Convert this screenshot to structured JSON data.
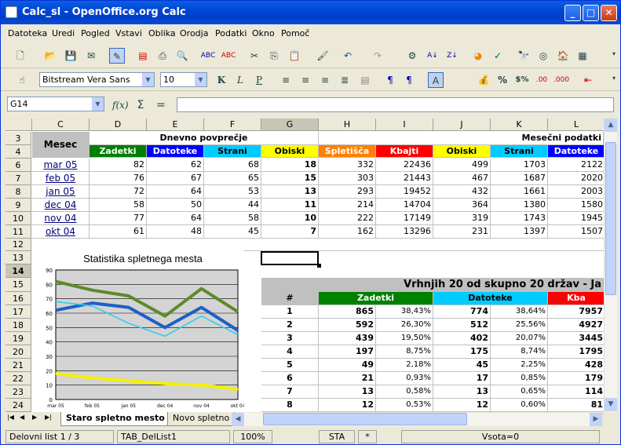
{
  "window": {
    "title": "Calc_sl - OpenOffice.org Calc"
  },
  "menu": [
    "Datoteka",
    "Uredi",
    "Pogled",
    "Vstavi",
    "Oblika",
    "Orodja",
    "Podatki",
    "Okno",
    "Pomoč"
  ],
  "format": {
    "font": "Bitstream Vera Sans",
    "size": "10"
  },
  "formula": {
    "cell_ref": "G14",
    "value": ""
  },
  "columns": [
    "C",
    "D",
    "E",
    "F",
    "G",
    "H",
    "I",
    "J",
    "K",
    "L"
  ],
  "headers": {
    "mesec": "Mesec",
    "dnevno": "Dnevno povprečje",
    "mesecni": "Mesečni podatki",
    "zadetki": "Zadetki",
    "datoteke": "Datoteke",
    "strani": "Strani",
    "obiski": "Obiski",
    "spletisca": "Spletišča",
    "kbajti": "Kbajti"
  },
  "rows": [
    {
      "row": "6",
      "mesec": "mar 05",
      "d": "82",
      "e": "62",
      "f": "68",
      "g": "18",
      "h": "332",
      "i": "22436",
      "j": "499",
      "k": "1703",
      "l": "2122"
    },
    {
      "row": "7",
      "mesec": "feb 05",
      "d": "76",
      "e": "67",
      "f": "65",
      "g": "15",
      "h": "303",
      "i": "21443",
      "j": "467",
      "k": "1687",
      "l": "2020"
    },
    {
      "row": "8",
      "mesec": "jan 05",
      "d": "72",
      "e": "64",
      "f": "53",
      "g": "13",
      "h": "293",
      "i": "19452",
      "j": "432",
      "k": "1661",
      "l": "2003"
    },
    {
      "row": "9",
      "mesec": "dec 04",
      "d": "58",
      "e": "50",
      "f": "44",
      "g": "11",
      "h": "214",
      "i": "14704",
      "j": "364",
      "k": "1380",
      "l": "1580"
    },
    {
      "row": "10",
      "mesec": "nov 04",
      "d": "77",
      "e": "64",
      "f": "58",
      "g": "10",
      "h": "222",
      "i": "17149",
      "j": "319",
      "k": "1743",
      "l": "1945"
    },
    {
      "row": "11",
      "mesec": "okt 04",
      "d": "61",
      "e": "48",
      "f": "45",
      "g": "7",
      "h": "162",
      "i": "13296",
      "j": "231",
      "k": "1397",
      "l": "1507"
    }
  ],
  "row_numbers": [
    "3",
    "4",
    "6",
    "7",
    "8",
    "9",
    "10",
    "11",
    "12",
    "13",
    "14",
    "15",
    "16",
    "17",
    "18",
    "19",
    "20",
    "21",
    "22",
    "23",
    "24",
    "25"
  ],
  "top20": {
    "title": "Vrhnjih 20 od skupno 20 držav - Ja",
    "hash": "#",
    "zadetki": "Zadetki",
    "datoteke": "Datoteke",
    "kbajti": "Kba",
    "rows": [
      {
        "n": "1",
        "z": "865",
        "zp": "38,43%",
        "d": "774",
        "dp": "38,64%",
        "k": "7957"
      },
      {
        "n": "2",
        "z": "592",
        "zp": "26,30%",
        "d": "512",
        "dp": "25,56%",
        "k": "4927"
      },
      {
        "n": "3",
        "z": "439",
        "zp": "19,50%",
        "d": "402",
        "dp": "20,07%",
        "k": "3445"
      },
      {
        "n": "4",
        "z": "197",
        "zp": "8,75%",
        "d": "175",
        "dp": "8,74%",
        "k": "1795"
      },
      {
        "n": "5",
        "z": "49",
        "zp": "2,18%",
        "d": "45",
        "dp": "2,25%",
        "k": "428"
      },
      {
        "n": "6",
        "z": "21",
        "zp": "0,93%",
        "d": "17",
        "dp": "0,85%",
        "k": "179"
      },
      {
        "n": "7",
        "z": "13",
        "zp": "0,58%",
        "d": "13",
        "dp": "0,65%",
        "k": "114"
      },
      {
        "n": "8",
        "z": "12",
        "zp": "0,53%",
        "d": "12",
        "dp": "0,60%",
        "k": "81"
      }
    ]
  },
  "chart_data": {
    "type": "line",
    "title": "Statistika spletnega mesta",
    "categories": [
      "mar 05",
      "feb 05",
      "jan 05",
      "dec 04",
      "nov 04",
      "okt 04"
    ],
    "ylim": [
      0,
      90
    ],
    "yticks": [
      "0",
      "10",
      "20",
      "30",
      "40",
      "50",
      "60",
      "70",
      "80",
      "90"
    ],
    "series": [
      {
        "values": [
          82,
          76,
          72,
          58,
          77,
          61
        ],
        "color": "#5e8a2a"
      },
      {
        "values": [
          62,
          67,
          64,
          50,
          64,
          48
        ],
        "color": "#1c5fc8"
      },
      {
        "values": [
          68,
          65,
          53,
          44,
          58,
          45
        ],
        "color": "#33ccee"
      },
      {
        "values": [
          18,
          15,
          13,
          11,
          10,
          7
        ],
        "color": "#f5f000"
      }
    ]
  },
  "sheet_tabs": [
    "Staro spletno mesto",
    "Novo spletno"
  ],
  "status": {
    "sheet": "Delovni list 1 / 3",
    "style": "TAB_DelList1",
    "zoom": "100%",
    "mode": "STA",
    "mod": "*",
    "sum": "Vsota=0"
  },
  "colors": {
    "zadetki": "#008000",
    "datoteke": "#0000ff",
    "strani": "#00ccff",
    "obiski": "#ffff00",
    "spletisca": "#ff8000",
    "kbajti": "#ff0000"
  }
}
